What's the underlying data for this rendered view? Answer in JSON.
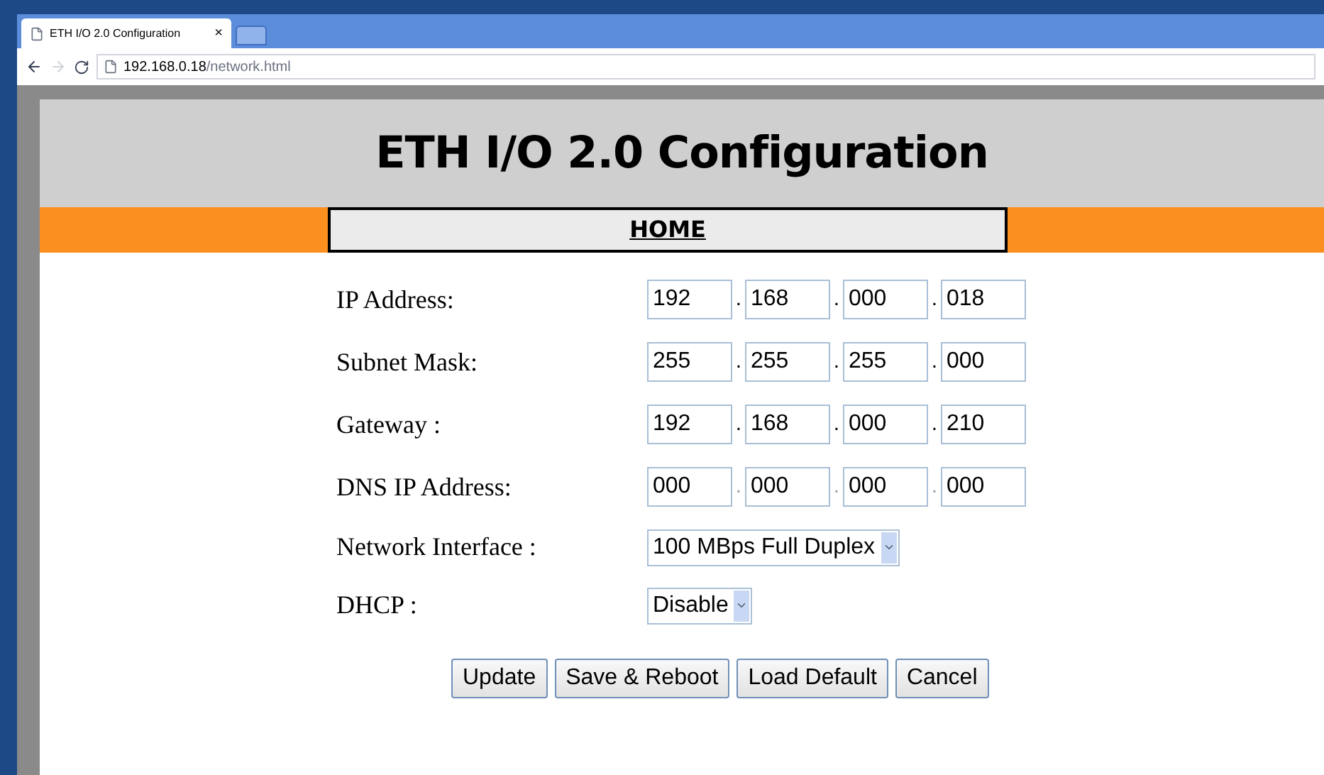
{
  "browser": {
    "tab_title": "ETH I/O 2.0 Configuration",
    "tab_close": "×",
    "url_host": "192.168.0.18",
    "url_path": "/network.html"
  },
  "page": {
    "title": "ETH I/O 2.0 Configuration",
    "nav_link": "HOME"
  },
  "form": {
    "ip_rows": [
      {
        "label": "IP Address:",
        "octets": [
          "192",
          "168",
          "000",
          "018"
        ],
        "separators": [
          ".",
          ".",
          "."
        ],
        "faded": false
      },
      {
        "label": "Subnet Mask:",
        "octets": [
          "255",
          "255",
          "255",
          "000"
        ],
        "separators": [
          ".",
          ".",
          "."
        ],
        "faded": false
      },
      {
        "label": "Gateway :",
        "octets": [
          "192",
          "168",
          "000",
          "210"
        ],
        "separators": [
          ".",
          ".",
          "."
        ],
        "faded": false
      },
      {
        "label": "DNS IP Address:",
        "octets": [
          "000",
          "000",
          "000",
          "000"
        ],
        "separators": [
          ".",
          ".",
          "."
        ],
        "faded": true
      }
    ],
    "selects": [
      {
        "label": "Network Interface :",
        "value": "100 MBps Full Duplex"
      },
      {
        "label": "DHCP :",
        "value": "Disable"
      }
    ]
  },
  "buttons": [
    "Update",
    "Save & Reboot",
    "Load Default",
    "Cancel"
  ]
}
